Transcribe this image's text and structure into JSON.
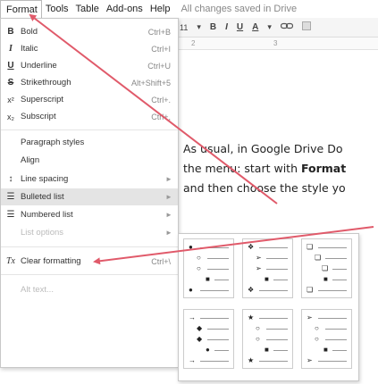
{
  "menubar": {
    "items": [
      "Format",
      "Tools",
      "Table",
      "Add-ons",
      "Help"
    ],
    "status": "All changes saved in Drive"
  },
  "toolbar": {
    "font_size": "11",
    "size_arrow": "▾",
    "bold": "B",
    "italic": "I",
    "underline": "U",
    "color": "A",
    "color_arrow": "▾",
    "link_icon": "link-icon",
    "comment_icon": "comment-icon"
  },
  "ruler": {
    "mark_2": "2",
    "mark_3": "3"
  },
  "format_menu": {
    "items": [
      {
        "icon": "B",
        "label": "Bold",
        "shortcut": "Ctrl+B"
      },
      {
        "icon": "I",
        "label": "Italic",
        "shortcut": "Ctrl+I"
      },
      {
        "icon": "U",
        "label": "Underline",
        "shortcut": "Ctrl+U"
      },
      {
        "icon": "S",
        "label": "Strikethrough",
        "shortcut": "Alt+Shift+5"
      },
      {
        "icon": "x²",
        "label": "Superscript",
        "shortcut": "Ctrl+."
      },
      {
        "icon": "x₂",
        "label": "Subscript",
        "shortcut": "Ctrl+,"
      },
      {
        "label": "Paragraph styles"
      },
      {
        "label": "Align"
      },
      {
        "icon": "↕",
        "label": "Line spacing",
        "arrow": "►"
      },
      {
        "icon": "☰",
        "label": "Bulleted list",
        "arrow": "►"
      },
      {
        "icon": "☰",
        "label": "Numbered list",
        "arrow": "►"
      },
      {
        "label": "List options",
        "arrow": "►"
      },
      {
        "icon": "Tx",
        "label": "Clear formatting",
        "shortcut": "Ctrl+\\"
      },
      {
        "label": "Alt text..."
      }
    ]
  },
  "document": {
    "line1_a": "As usual, in Google Drive Do",
    "line2_a": "the menu: start with ",
    "line2_b": "Format",
    "line3_a": "and then choose the style yo"
  },
  "colors": {
    "arrow": "#e05a6a",
    "highlight": "#e4e4e4",
    "menu_border": "#c8c8c8"
  }
}
